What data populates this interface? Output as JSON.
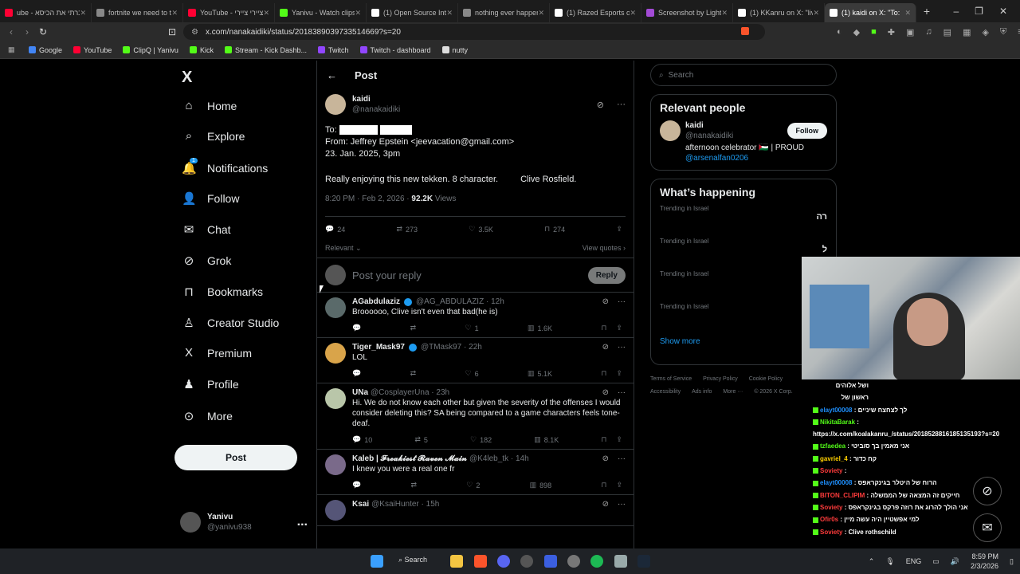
{
  "tabs": [
    {
      "label": "ube - שברתי את הכיסא",
      "color": "#ff0033"
    },
    {
      "label": "fortnite we need to talk",
      "color": "#888888"
    },
    {
      "label": "YouTube - ציירי ציירי",
      "color": "#ff0033"
    },
    {
      "label": "Yanivu - Watch clips on",
      "color": "#53fc18"
    },
    {
      "label": "(1) Open Source Intel on",
      "color": "#ffffff"
    },
    {
      "label": "nothing ever happens",
      "color": "#888888"
    },
    {
      "label": "(1) Razed Esports on X",
      "color": "#ffffff"
    },
    {
      "label": "Screenshot by Lightshot",
      "color": "#a34bd6"
    },
    {
      "label": "(1) KKanru on X: \"live q",
      "color": "#ffffff"
    },
    {
      "label": "(1) kaidi on X: \"To:",
      "color": "#ffffff"
    }
  ],
  "browser": {
    "url": "x.com/nanakaidiki/status/2018389039733514669?s=20"
  },
  "bookmarks": [
    {
      "label": "Google",
      "color": "#4285f4"
    },
    {
      "label": "YouTube",
      "color": "#ff0033"
    },
    {
      "label": "ClipQ | Yanivu",
      "color": "#53fc18"
    },
    {
      "label": "Kick",
      "color": "#53fc18"
    },
    {
      "label": "Stream - Kick Dashb...",
      "color": "#53fc18"
    },
    {
      "label": "Twitch",
      "color": "#9146ff"
    },
    {
      "label": "Twitch - dashboard",
      "color": "#9146ff"
    },
    {
      "label": "nutty",
      "color": "#dddddd"
    }
  ],
  "nav": {
    "logo": "X",
    "items": [
      "Home",
      "Explore",
      "Notifications",
      "Follow",
      "Chat",
      "Grok",
      "Bookmarks",
      "Creator Studio",
      "Premium",
      "Profile",
      "More"
    ],
    "notif_badge": "1",
    "post": "Post",
    "account": {
      "name": "Yanivu",
      "handle": "@yanivu938",
      "more": "..."
    }
  },
  "post_header": {
    "back": "←",
    "title": "Post"
  },
  "tweet": {
    "name": "kaidi",
    "handle": "@nanakaidiki",
    "to": "To:",
    "from": "From: Jeffrey Epstein <jeevacation@gmail.com>",
    "date": "23. Jan. 2025,  3pm",
    "body1": "Really enjoying this new tekken.  8 character.",
    "body2": "Clive Rosfield.",
    "time": "8:20 PM · Feb 2, 2026 · ",
    "views_count": "92.2K",
    "views_label": " Views",
    "replies": "24",
    "reposts": "273",
    "likes": "3.5K",
    "bookmarks": "274",
    "sort": "Relevant",
    "view_quotes": "View quotes"
  },
  "reply_box": {
    "placeholder": "Post your reply",
    "button": "Reply"
  },
  "replies": [
    {
      "name": "AGabdulaziz",
      "verified": true,
      "handle": "@AG_ABDULAZIZ · 12h",
      "text": "Broooooo, Clive isn't even that bad(he is)",
      "reposts": "",
      "likes": "1",
      "views": "1.6K"
    },
    {
      "name": "Tiger_Mask97",
      "verified": true,
      "handle": "@TMask97 · 22h",
      "text": "LOL",
      "reposts": "",
      "likes": "6",
      "views": "5.1K"
    },
    {
      "name": "UNa",
      "verified": false,
      "handle": "@CosplayerUna · 23h",
      "text": "Hi. We do not know each other but given the severity of the offenses I would consider deleting this? SA being compared to a game characters feels tone-deaf.",
      "replies": "10",
      "reposts": "5",
      "likes": "182",
      "views": "8.1K"
    },
    {
      "name": "Kaleb | 𝓕𝓻𝓮𝓪𝓴𝓲𝓮𝓼𝓽 𝓡𝓪𝓿𝓮𝓷 𝓜𝓪𝓲𝓷",
      "verified": false,
      "handle": "@K4leb_tk · 14h",
      "text": "I knew you were a real one fr",
      "reposts": "",
      "likes": "2",
      "views": "898"
    },
    {
      "name": "Ksai",
      "verified": false,
      "handle": "@KsaiHunter · 15h",
      "text": "",
      "reposts": "",
      "likes": "",
      "views": ""
    }
  ],
  "right": {
    "search_placeholder": "Search",
    "relevant_title": "Relevant people",
    "person": {
      "name": "kaidi",
      "handle": "@nanakaidiki",
      "bio": "afternoon celebrator 🇵🇸 | PROUD",
      "bio_link": "@arsenalfan0206",
      "follow": "Follow"
    },
    "happening_title": "What’s happening",
    "trends": [
      {
        "label": "Trending in Israel",
        "topic": "רה"
      },
      {
        "label": "Trending in Israel",
        "topic": "ל"
      },
      {
        "label": "Trending in Israel",
        "topic": "שלמה"
      },
      {
        "label": "Trending in Israel",
        "topic": ""
      }
    ],
    "show_more": "Show more",
    "footer": [
      "Terms of Service",
      "Privacy Policy",
      "Cookie Policy",
      "Accessibility",
      "Ads info",
      "More ···",
      "© 2026 X Corp."
    ]
  },
  "chat": [
    {
      "user": "",
      "msg": "ושל אלוהים",
      "color": "#ffffff"
    },
    {
      "user": "",
      "msg": "ראשון של",
      "color": "#ffffff"
    },
    {
      "user": "elayt00008",
      "msg": ": לך לצחצח שיניים",
      "color": "#1e90ff"
    },
    {
      "user": "NikitaBarak",
      "msg": ":",
      "color": "#53fc18"
    },
    {
      "user": "",
      "msg": "https://x.com/koalakanru_/status/2018528816185135193?s=20",
      "color": "#ffffff"
    },
    {
      "user": "tzfaedea",
      "msg": ": אני מאמין בך סוביטי",
      "color": "#53fc18"
    },
    {
      "user": "gavriel_4",
      "msg": ": קח כדור",
      "color": "#ffd000"
    },
    {
      "user": "Soviety",
      "msg": ":",
      "color": "#ff3b3b"
    },
    {
      "user": "elayt00008",
      "msg": ": הרוח של היטלר בגינקראפס",
      "color": "#1e90ff"
    },
    {
      "user": "BITON_CLIPIM",
      "msg": ": חייקים זה המצאה של הממשלה",
      "color": "#ff3b3b"
    },
    {
      "user": "Soviety",
      "msg": ": אני הולך להרוג את רוזה פרקס בגינקראפס",
      "color": "#ff3b3b"
    },
    {
      "user": "Ofir0s",
      "msg": ": למי אפשטיין היה עשה מיין",
      "color": "#ff3b3b"
    },
    {
      "user": "Soviety",
      "msg": ": Clive rothschild",
      "color": "#ff3b3b"
    }
  ],
  "taskbar": {
    "search": "Search",
    "lang": "ENG",
    "time": "8:59 PM",
    "date": "2/3/2026"
  }
}
